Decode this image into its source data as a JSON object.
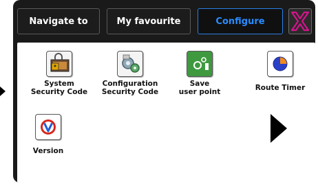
{
  "tabs": {
    "navigate": "Navigate to",
    "favourite": "My favourite",
    "configure": "Configure"
  },
  "close_icon": "close-x-icon",
  "items": [
    {
      "label": "System\nSecurity Code",
      "icon": "system-security-icon"
    },
    {
      "label": "Configuration\nSecurity Code",
      "icon": "configuration-security-icon"
    },
    {
      "label": "Save\nuser point",
      "icon": "save-user-point-icon"
    },
    {
      "label": "Route Timer",
      "icon": "route-timer-icon"
    },
    {
      "label": "Version",
      "icon": "version-icon"
    }
  ],
  "next_icon": "next-page-arrow-icon",
  "colors": {
    "active_tab": "#2a8cff",
    "close_x": "#d4148c",
    "frame": "#1a1a1a"
  }
}
